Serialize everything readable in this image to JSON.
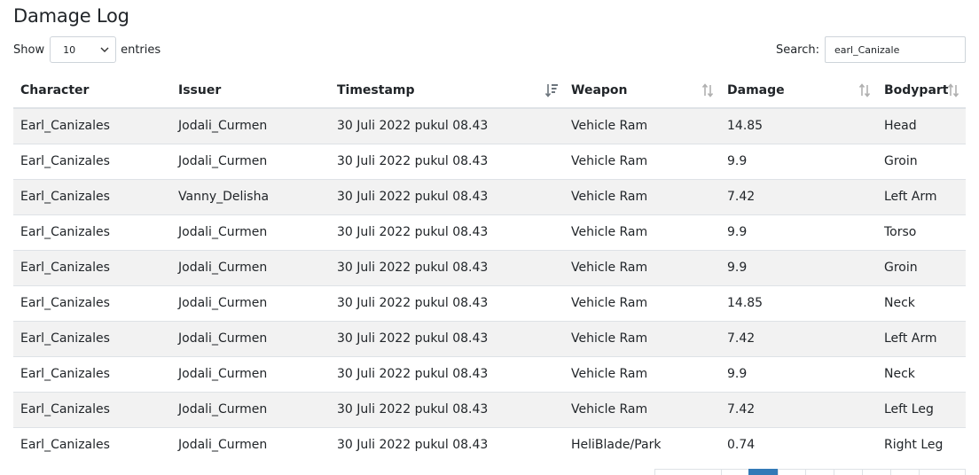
{
  "page": {
    "title": "Damage Log"
  },
  "length": {
    "prefix": "Show",
    "value": "10",
    "suffix": "entries"
  },
  "search": {
    "label": "Search:",
    "value": "earl_Canizale"
  },
  "table": {
    "columns": [
      "Character",
      "Issuer",
      "Timestamp",
      "Weapon",
      "Damage",
      "Bodypart"
    ],
    "rows": [
      [
        "Earl_Canizales",
        "Jodali_Curmen",
        "30 Juli 2022 pukul 08.43",
        "Vehicle Ram",
        "14.85",
        "Head"
      ],
      [
        "Earl_Canizales",
        "Jodali_Curmen",
        "30 Juli 2022 pukul 08.43",
        "Vehicle Ram",
        "9.9",
        "Groin"
      ],
      [
        "Earl_Canizales",
        "Vanny_Delisha",
        "30 Juli 2022 pukul 08.43",
        "Vehicle Ram",
        "7.42",
        "Left Arm"
      ],
      [
        "Earl_Canizales",
        "Jodali_Curmen",
        "30 Juli 2022 pukul 08.43",
        "Vehicle Ram",
        "9.9",
        "Torso"
      ],
      [
        "Earl_Canizales",
        "Jodali_Curmen",
        "30 Juli 2022 pukul 08.43",
        "Vehicle Ram",
        "9.9",
        "Groin"
      ],
      [
        "Earl_Canizales",
        "Jodali_Curmen",
        "30 Juli 2022 pukul 08.43",
        "Vehicle Ram",
        "14.85",
        "Neck"
      ],
      [
        "Earl_Canizales",
        "Jodali_Curmen",
        "30 Juli 2022 pukul 08.43",
        "Vehicle Ram",
        "7.42",
        "Left Arm"
      ],
      [
        "Earl_Canizales",
        "Jodali_Curmen",
        "30 Juli 2022 pukul 08.43",
        "Vehicle Ram",
        "9.9",
        "Neck"
      ],
      [
        "Earl_Canizales",
        "Jodali_Curmen",
        "30 Juli 2022 pukul 08.43",
        "Vehicle Ram",
        "7.42",
        "Left Leg"
      ],
      [
        "Earl_Canizales",
        "Jodali_Curmen",
        "30 Juli 2022 pukul 08.43",
        "HeliBlade/Park",
        "0.74",
        "Right Leg"
      ]
    ]
  },
  "colors": {
    "accent": "#337ab7",
    "stripe": "#f2f2f2",
    "border": "#dee2e6",
    "sort_icon": "#b0b0b0",
    "sort_active": "#6c757d"
  },
  "icons": {
    "sort_active": "sort-desc-icon",
    "sort_idle": "sort-both-icon",
    "select": "chevron-down-icon"
  }
}
